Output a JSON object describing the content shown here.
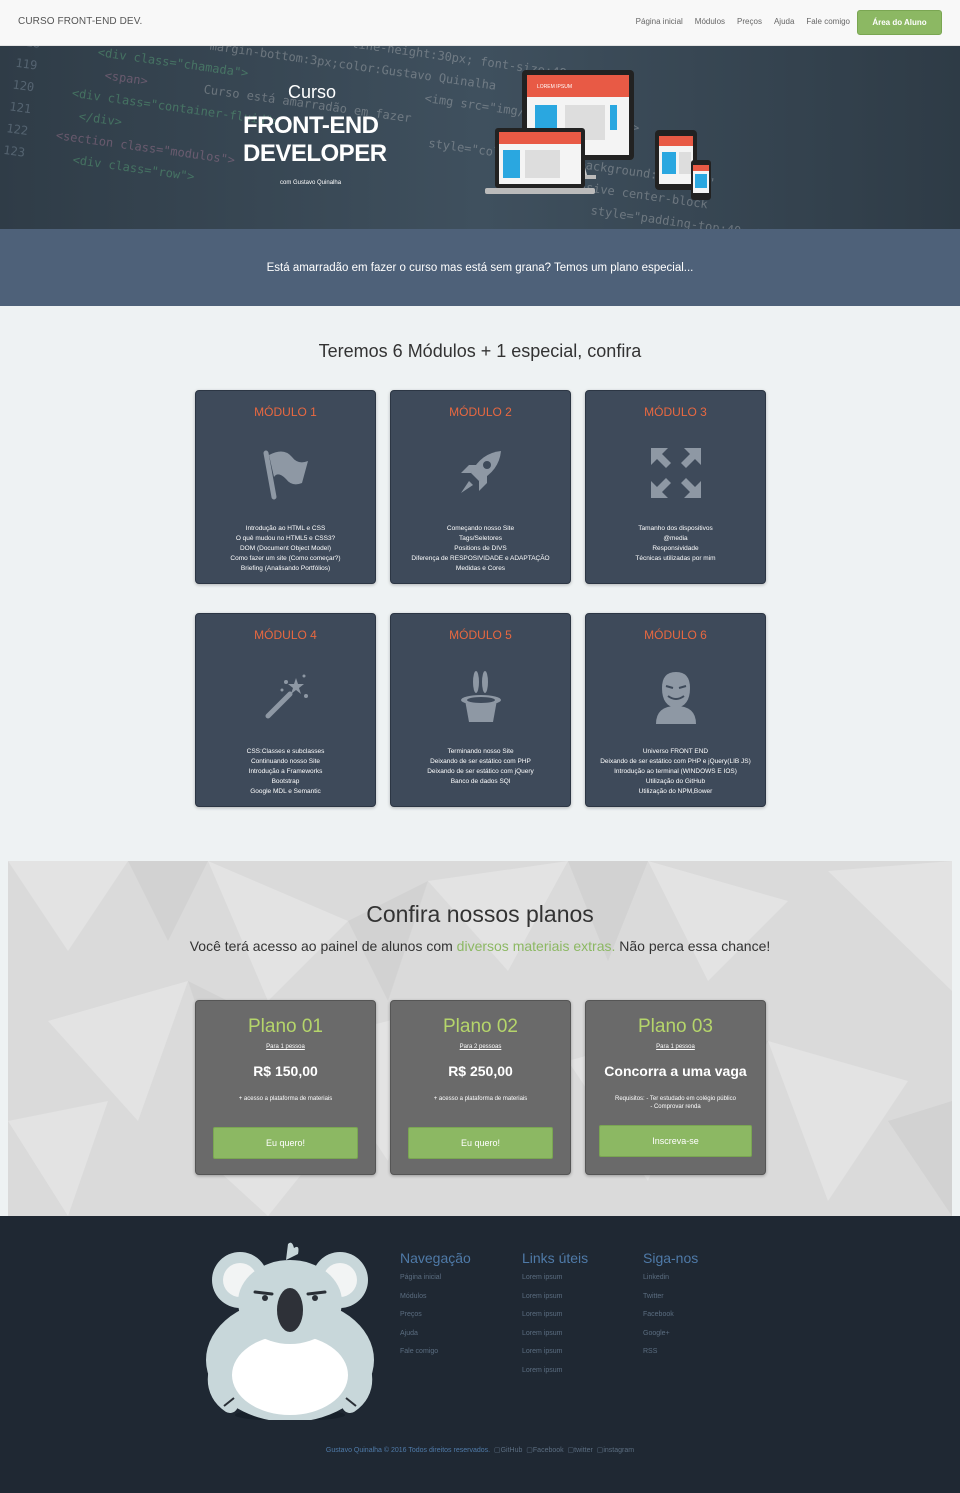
{
  "navbar": {
    "brand": "CURSO FRONT-END DEV.",
    "links": [
      "Página inicial",
      "Módulos",
      "Preços",
      "Ajuda",
      "Fale comigo"
    ],
    "cta": "Área do Aluno",
    "cta_color": "#8cb863"
  },
  "hero": {
    "curso": "Curso",
    "title_line1": "FRONT-END",
    "title_line2": "DEVELOPER",
    "author": "com Gustavo Quinalha",
    "device_label": "LOREM IPSUM"
  },
  "promo": {
    "text": "Está amarradão em fazer o curso mas está sem grana? Temos um plano especial..."
  },
  "modules_section": {
    "heading": "Teremos 6 Módulos + 1 especial, confira",
    "modules": [
      {
        "title": "MÓDULO 1",
        "icon": "flag-icon",
        "topics": [
          "Introdução ao HTML e CSS",
          "O quê mudou no HTML5 e CSS3?",
          "DOM (Document Object Model)",
          "Como fazer um site (Como começar?)",
          "Briefing (Analisando Portfólios)"
        ]
      },
      {
        "title": "MÓDULO 2",
        "icon": "rocket-icon",
        "topics": [
          "Começando nosso Site",
          "Tags/Seletores",
          "Positions de DIVS",
          "Diferença de RESPOSIVIDADE e ADAPTAÇÃO",
          "Medidas e Cores"
        ]
      },
      {
        "title": "MÓDULO 3",
        "icon": "expand-arrows-icon",
        "topics": [
          "Tamanho dos dispositivos",
          "@media",
          "Responsividade",
          "Técnicas utilizadas por mim"
        ]
      },
      {
        "title": "MÓDULO 4",
        "icon": "magic-wand-icon",
        "topics": [
          "CSS:Classes e subclasses",
          "Continuando nosso Site",
          "Introdução a Frameworks",
          "Bootstrap",
          "Google MDL e Semantic"
        ]
      },
      {
        "title": "MÓDULO 5",
        "icon": "magic-hat-icon",
        "topics": [
          "Terminando nosso Site",
          "Deixando de ser estático com PHP",
          "Deixando de ser estático com jQuery",
          "Banco de dados SQl"
        ]
      },
      {
        "title": "MÓDULO 6",
        "icon": "anonymous-mask-icon",
        "topics": [
          "Universo FRONT END",
          "Deixando de ser estático com PHP e jQuery(LIB JS)",
          "Introdução ao terminal (WINDOWS E IOS)",
          "Utilização do GitHub",
          "Utilização do NPM,Bower"
        ]
      }
    ],
    "title_color": "#e96840"
  },
  "plans_section": {
    "title": "Confira nossos planos",
    "subtitle_before": "Você terá acesso ao painel de alunos com ",
    "subtitle_highlight": "diversos materiais extras.",
    "subtitle_after": " Não perca essa chance!",
    "plans": [
      {
        "name": "Plano 01",
        "people": "Para 1 pessoa",
        "price": "R$ 150,00",
        "desc_line1": "+ acesso a plataforma de materiais",
        "desc_line2": "",
        "button": "Eu quero!"
      },
      {
        "name": "Plano 02",
        "people": "Para 2 pessoas",
        "price": "R$ 250,00",
        "desc_line1": "+ acesso a plataforma de materiais",
        "desc_line2": "",
        "button": "Eu quero!"
      },
      {
        "name": "Plano 03",
        "people": "Para 1 pessoa",
        "price": "Concorra a uma vaga",
        "desc_line1": "Requisitos: - Ter estudado em colégio público",
        "desc_line2": "- Comprovar renda",
        "button": "Inscreva-se"
      }
    ],
    "name_color": "#b5d56b"
  },
  "footer": {
    "columns": [
      {
        "title": "Navegação",
        "links": [
          "Página inicial",
          "Módulos",
          "Preços",
          "Ajuda",
          "Fale comigo"
        ]
      },
      {
        "title": "Links úteis",
        "links": [
          "Lorem ipsum",
          "Lorem ipsum",
          "Lorem ipsum",
          "Lorem ipsum",
          "Lorem ipsum",
          "Lorem ipsum"
        ]
      },
      {
        "title": "Siga-nos",
        "links": [
          "Linkedin",
          "Twitter",
          "Facebook",
          "Google+",
          "RSS"
        ]
      }
    ],
    "copyright": "Gustavo Quinalha © 2016 Todos direitos reservados.",
    "social": [
      "GitHub",
      "Facebook",
      "twitter",
      "instagram"
    ],
    "mascot_icon": "koala-mascot-icon"
  }
}
